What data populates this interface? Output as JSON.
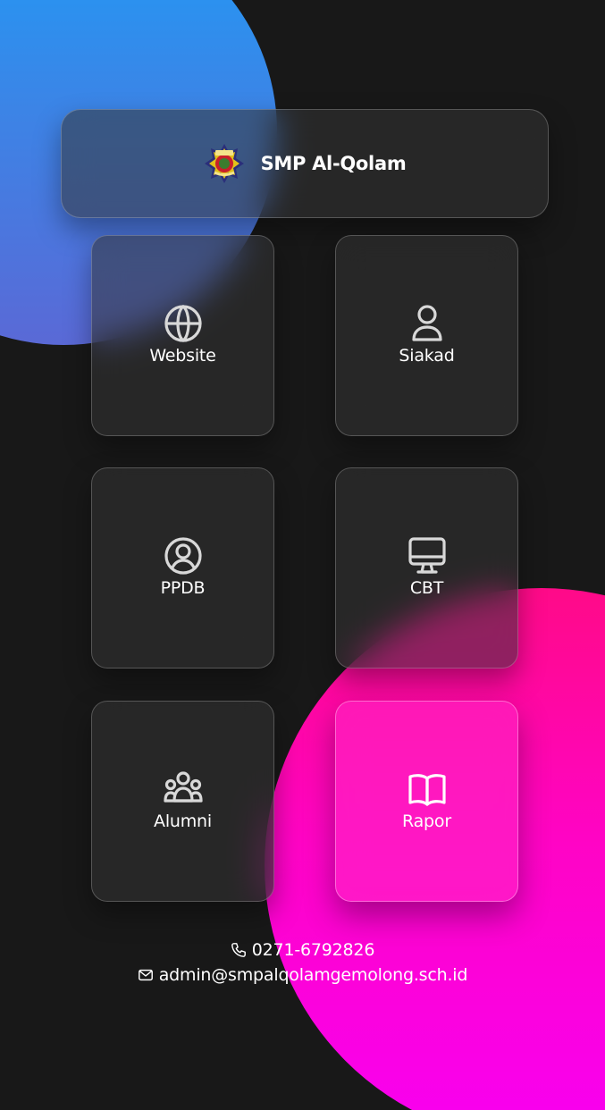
{
  "app": {
    "title": "SMP Al-Qolam",
    "logo_icon": "school-emblem-icon"
  },
  "menu": [
    {
      "id": "website",
      "label": "Website",
      "icon": "globe-icon",
      "active": false
    },
    {
      "id": "siakad",
      "label": "Siakad",
      "icon": "user-icon",
      "active": false
    },
    {
      "id": "ppdb",
      "label": "PPDB",
      "icon": "user-circle-icon",
      "active": false
    },
    {
      "id": "cbt",
      "label": "CBT",
      "icon": "monitor-icon",
      "active": false
    },
    {
      "id": "alumni",
      "label": "Alumni",
      "icon": "users-group-icon",
      "active": false
    },
    {
      "id": "rapor",
      "label": "Rapor",
      "icon": "open-book-icon",
      "active": true
    }
  ],
  "contact": {
    "phone": "0271-6792826",
    "phone_icon": "phone-icon",
    "email": "admin@smpalqolamgemolong.sch.id",
    "email_icon": "mail-icon"
  },
  "colors": {
    "background": "#181818",
    "blob_blue": "#1f9bf6",
    "blob_pink": "#ff0a88",
    "active_card": "#ff28c4",
    "icon_stroke": "#d8d8d8",
    "text": "#ffffff"
  }
}
